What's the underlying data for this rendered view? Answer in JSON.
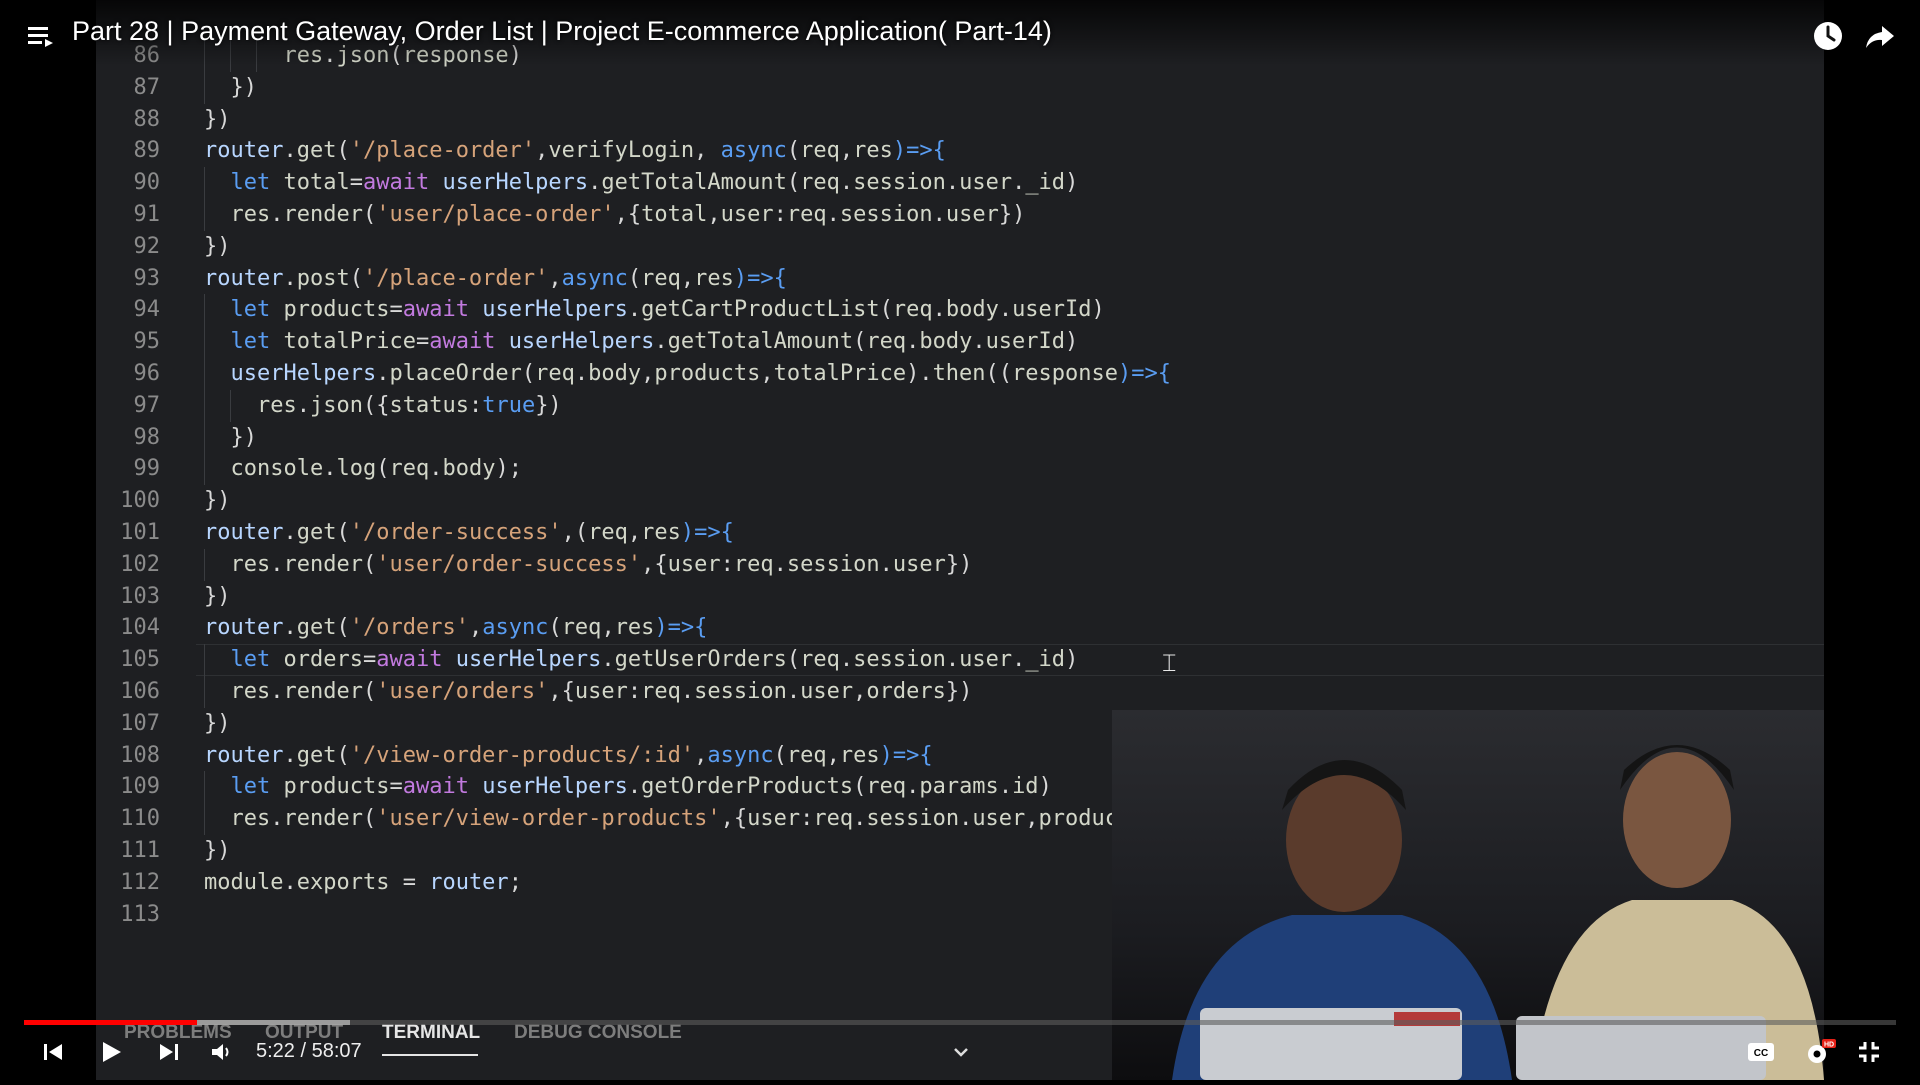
{
  "title": "Part 28 | Payment Gateway, Order List | Project E-commerce Application( Part-14)",
  "player": {
    "current_time": "5:22",
    "separator": " / ",
    "duration": "58:07",
    "progress_fraction": 0.0924,
    "buffer_fraction": 0.082,
    "accent": "#ff0000",
    "hd_badge": "HD"
  },
  "panel": {
    "tabs": [
      {
        "label": "PROBLEMS",
        "active": false
      },
      {
        "label": "OUTPUT",
        "active": false
      },
      {
        "label": "TERMINAL",
        "active": true
      },
      {
        "label": "DEBUG CONSOLE",
        "active": false
      }
    ]
  },
  "code": {
    "lines": [
      {
        "n": "86",
        "text": "      res.json(response)"
      },
      {
        "n": "87",
        "text": "  })"
      },
      {
        "n": "88",
        "text": "})"
      },
      {
        "n": "89",
        "text": "router.get('/place-order',verifyLogin, async(req,res)=>{"
      },
      {
        "n": "90",
        "text": "  let total=await userHelpers.getTotalAmount(req.session.user._id)"
      },
      {
        "n": "91",
        "text": "  res.render('user/place-order',{total,user:req.session.user})"
      },
      {
        "n": "92",
        "text": "})"
      },
      {
        "n": "93",
        "text": "router.post('/place-order',async(req,res)=>{"
      },
      {
        "n": "94",
        "text": "  let products=await userHelpers.getCartProductList(req.body.userId)"
      },
      {
        "n": "95",
        "text": "  let totalPrice=await userHelpers.getTotalAmount(req.body.userId)"
      },
      {
        "n": "96",
        "text": "  userHelpers.placeOrder(req.body,products,totalPrice).then((response)=>{"
      },
      {
        "n": "97",
        "text": "    res.json({status:true})"
      },
      {
        "n": "98",
        "text": "  })"
      },
      {
        "n": "99",
        "text": "  console.log(req.body);"
      },
      {
        "n": "100",
        "text": "})"
      },
      {
        "n": "101",
        "text": "router.get('/order-success',(req,res)=>{"
      },
      {
        "n": "102",
        "text": "  res.render('user/order-success',{user:req.session.user})"
      },
      {
        "n": "103",
        "text": "})"
      },
      {
        "n": "104",
        "text": "router.get('/orders',async(req,res)=>{"
      },
      {
        "n": "105",
        "text": "  let orders=await userHelpers.getUserOrders(req.session.user._id)"
      },
      {
        "n": "106",
        "text": "  res.render('user/orders',{user:req.session.user,orders})"
      },
      {
        "n": "107",
        "text": "})"
      },
      {
        "n": "108",
        "text": "router.get('/view-order-products/:id',async(req,res)=>{"
      },
      {
        "n": "109",
        "text": "  let products=await userHelpers.getOrderProducts(req.params.id)"
      },
      {
        "n": "110",
        "text": "  res.render('user/view-order-products',{user:req.session.user,products})"
      },
      {
        "n": "111",
        "text": "})"
      },
      {
        "n": "112",
        "text": "module.exports = router;"
      },
      {
        "n": "113",
        "text": ""
      }
    ],
    "active_line": "105"
  },
  "icons": {
    "menu": "playlist-icon",
    "watch_later": "clock-icon",
    "share": "share-icon",
    "prev": "previous-icon",
    "play": "play-icon",
    "next": "next-icon",
    "volume": "volume-icon",
    "chevron": "chevron-down-icon",
    "cc": "captions-icon",
    "settings": "settings-icon",
    "exit_fullscreen": "exit-fullscreen-icon"
  }
}
